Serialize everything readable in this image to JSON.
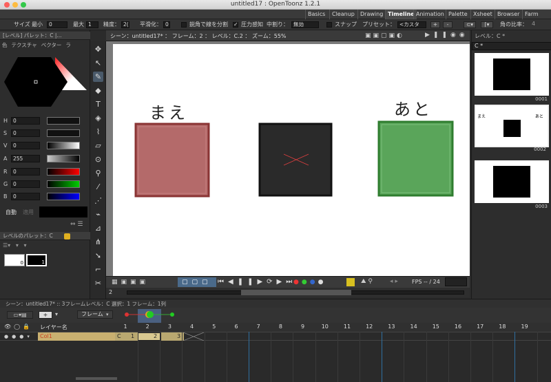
{
  "window": {
    "title": "untitled17 : OpenToonz 1.2.1"
  },
  "rooms": {
    "tabs": [
      "Basics",
      "Cleanup",
      "Drawing",
      "Timeline",
      "Animation",
      "Palette",
      "Xsheet",
      "Browser",
      "Farm"
    ],
    "active": "Timeline"
  },
  "tool_options": {
    "size_label": "サイズ",
    "min_label": "最小",
    "min_value": "0",
    "max_label": "最大",
    "max_value": "1",
    "accuracy_label": "精度：",
    "accuracy_value": "2(",
    "smooth_label": "平滑化：",
    "smooth_value": "0",
    "break_label": "鋭角で線を分割",
    "pressure_label": "圧力感知",
    "pressure_checked": true,
    "fill_label": "中割り：",
    "fill_value": "無効",
    "snap_label": "スナップ",
    "preset_label": "プリセット：",
    "preset_value": "<カスタ",
    "add_preset": "+",
    "remove_preset": "-",
    "cap_label": "角の比率：",
    "cap_value": "4"
  },
  "style_editor": {
    "header": "[レベル]  パレット：C |...",
    "tabs": [
      "色",
      "テクスチャ",
      "ベクター",
      "ラ"
    ],
    "channels": [
      {
        "label": "H",
        "value": "0"
      },
      {
        "label": "S",
        "value": "0"
      },
      {
        "label": "V",
        "value": "0"
      },
      {
        "label": "A",
        "value": "255"
      },
      {
        "label": "R",
        "value": "0"
      },
      {
        "label": "G",
        "value": "0"
      },
      {
        "label": "B",
        "value": "0"
      }
    ],
    "auto_label": "自動",
    "apply_label": "適用"
  },
  "level_palette": {
    "header": "レベルのパレット：C",
    "chip_0": "0",
    "chip_1": "1"
  },
  "viewer": {
    "header": "シーン：untitled17*  ：  フレーム：2  ：  レベル：C.2  ：  ズーム：55%",
    "before_text": "まえ",
    "after_text": "あと",
    "fps_label": "FPS -- / 24",
    "frame_value": "2",
    "colors": {
      "before": "#b46a6a",
      "middle": "#2a2a2a",
      "after": "#5aa55a",
      "cross": "#e04040"
    }
  },
  "level_strip": {
    "header": "レベル：C *",
    "selector": "C *",
    "frames": [
      {
        "label": "0001"
      },
      {
        "label": "0002",
        "before": "まえ",
        "after": "あと"
      },
      {
        "label": "0003"
      }
    ]
  },
  "timeline": {
    "header": "シーン：untitled17*  ::  3フレームレベル：C  選択：1 フレーム：1列",
    "frame_mode": "フレーム",
    "layer_header": "レイヤー名",
    "layer_name": "Col1",
    "cell_level": "C",
    "cell_frames": [
      "1",
      "2",
      "3"
    ],
    "frames": [
      "1",
      "2",
      "3",
      "4",
      "5",
      "6",
      "7",
      "8",
      "9",
      "10",
      "11",
      "12",
      "13",
      "14",
      "15",
      "16",
      "17",
      "18",
      "19"
    ]
  }
}
